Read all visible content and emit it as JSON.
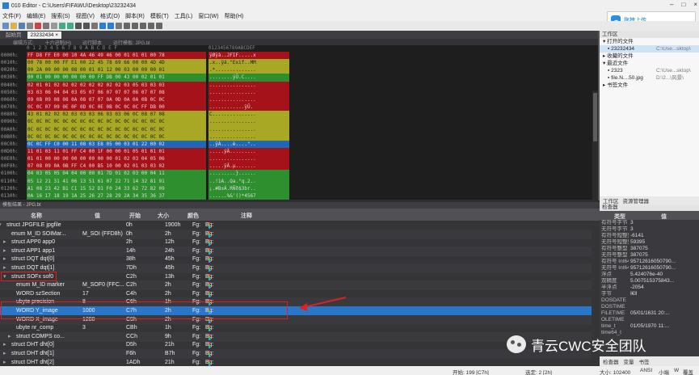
{
  "window": {
    "title": "010 Editor - C:\\Users\\FIFAWU\\Desktop\\23232434",
    "controls": [
      "–",
      "□",
      "×"
    ]
  },
  "menu": [
    "文件(F)",
    "编辑(E)",
    "搜索(S)",
    "视图(V)",
    "格式(O)",
    "脚本(R)",
    "模板(T)",
    "工具(L)",
    "窗口(W)",
    "帮助(H)"
  ],
  "popup": {
    "label": "拖拽上传"
  },
  "tabs": {
    "start": "起始页",
    "file": "23232434 ×"
  },
  "subbar": [
    "编辑方式:",
    "十六进制(H)",
    "运行脚本",
    "运行模板: JPG.bt"
  ],
  "hex": {
    "header_cols": "0  1  2  3  4  5  6  7  8  9  A  B  C  D  E  F",
    "header_ascii": "0123456789ABCDEF",
    "rows": [
      {
        "addr": "0000h:",
        "bytes": "FF D8 FF E0 00 10 4A 46 49 46 00 01 01 01 00 78",
        "ascii": "ÿØÿà..JFIF.....x",
        "color": "red"
      },
      {
        "addr": "0010h:",
        "bytes": "00 78 00 00 FF E1 00 22 45 78 69 66 00 00 4D 4D",
        "ascii": ".x..ÿá.\"Exif..MM",
        "color": "olive"
      },
      {
        "addr": "0020h:",
        "bytes": "00 2A 00 00 00 08 00 01 01 12 00 03 00 00 00 01",
        "ascii": ".*..............",
        "color": "olive"
      },
      {
        "addr": "0030h:",
        "bytes": "00 01 00 00 00 00 00 00 FF DB 00 43 00 02 01 01",
        "ascii": "........ÿÛ.C....",
        "color": "green"
      },
      {
        "addr": "0040h:",
        "bytes": "02 01 01 02 02 02 02 02 02 02 02 03 05 03 03 03",
        "ascii": "................",
        "color": "red"
      },
      {
        "addr": "0050h:",
        "bytes": "03 03 06 04 04 03 05 07 06 07 07 07 06 07 07 08",
        "ascii": "................",
        "color": "red"
      },
      {
        "addr": "0060h:",
        "bytes": "09 0B 09 08 08 0A 08 07 07 0A 0D 0A 0A 0B 0C 0C",
        "ascii": "................",
        "color": "red"
      },
      {
        "addr": "0070h:",
        "bytes": "0C 0C 07 09 0E 0F 0D 0C 0E 0B 0C 0C 0C FF DB 00",
        "ascii": "............ÿÛ.",
        "color": "red"
      },
      {
        "addr": "0080h:",
        "bytes": "43 01 02 02 02 03 03 03 06 03 03 06 0C 08 07 08",
        "ascii": "C...............",
        "color": "olive"
      },
      {
        "addr": "0090h:",
        "bytes": "0C 0C 0C 0C 0C 0C 0C 0C 0C 0C 0C 0C 0C 0C 0C 0C",
        "ascii": "................",
        "color": "olive"
      },
      {
        "addr": "00A0h:",
        "bytes": "0C 0C 0C 0C 0C 0C 0C 0C 0C 0C 0C 0C 0C 0C 0C 0C",
        "ascii": "................",
        "color": "olive"
      },
      {
        "addr": "00B0h:",
        "bytes": "0C 0C 0C 0C 0C 0C 0C 0C 0C 0C 0C 0C 0C 0C 0C 0C",
        "ascii": "................",
        "color": "olive"
      },
      {
        "addr": "00C0h:",
        "bytes": "0C 0C FF C0 00 11 08 03 E8 05 00 03 01 22 00 02",
        "ascii": "..ÿÀ....è....\"..",
        "color": "blue"
      },
      {
        "addr": "00D0h:",
        "bytes": "11 01 03 11 01 FF C4 00 1F 00 00 01 05 01 01 01",
        "ascii": ".....ÿÄ.........",
        "color": "red"
      },
      {
        "addr": "00E0h:",
        "bytes": "01 01 00 00 00 00 00 00 00 00 01 02 03 04 05 06",
        "ascii": "................",
        "color": "red"
      },
      {
        "addr": "00F0h:",
        "bytes": "07 08 09 0A 0B FF C4 00 B5 10 00 02 01 03 03 02",
        "ascii": ".....ÿÄ.µ.......",
        "color": "red"
      },
      {
        "addr": "0100h:",
        "bytes": "04 03 05 05 04 04 00 00 01 7D 01 02 03 00 04 11",
        "ascii": ".........}......",
        "color": "green"
      },
      {
        "addr": "0110h:",
        "bytes": "05 12 21 31 41 06 13 51 61 07 22 71 14 32 81 91",
        "ascii": "..!1A..Qa.\"q.2..",
        "color": "green"
      },
      {
        "addr": "0120h:",
        "bytes": "A1 08 23 42 B1 C1 15 52 D1 F0 24 33 62 72 82 09",
        "ascii": "¡.#B±Á.RÑð$3br..",
        "color": "green"
      },
      {
        "addr": "0130h:",
        "bytes": "0A 16 17 18 19 1A 25 26 27 28 29 2A 34 35 36 37",
        "ascii": "......%&'()*4567",
        "color": "green"
      }
    ]
  },
  "template": {
    "header": "模板结果 - JPG.bt",
    "columns": [
      "名称",
      "值",
      "开始",
      "大小",
      "颜色",
      "注释"
    ],
    "rows": [
      {
        "name": "struct JPGFILE jpgfile",
        "value": "",
        "start": "0h",
        "size": "1900h",
        "fg": "Fg:",
        "bg": "Bg:",
        "indent": 0
      },
      {
        "name": "enum M_ID SOIMar...",
        "value": "M_SOI (FFD8h)",
        "start": "0h",
        "size": "2h",
        "fg": "Fg:",
        "bg": "Bg:",
        "indent": 1
      },
      {
        "name": "struct APP0 app0",
        "value": "",
        "start": "2h",
        "size": "12h",
        "fg": "Fg:",
        "bg": "Bg:",
        "indent": 1
      },
      {
        "name": "struct APP1 app1",
        "value": "",
        "start": "14h",
        "size": "24h",
        "fg": "Fg:",
        "bg": "Bg:",
        "indent": 1
      },
      {
        "name": "struct DQT dqt[0]",
        "value": "",
        "start": "38h",
        "size": "45h",
        "fg": "Fg:",
        "bg": "Bg:",
        "indent": 1
      },
      {
        "name": "struct DQT dqt[1]",
        "value": "",
        "start": "7Dh",
        "size": "45h",
        "fg": "Fg:",
        "bg": "Bg:",
        "indent": 1
      },
      {
        "name": "struct SOFx sof0",
        "value": "",
        "start": "C2h",
        "size": "13h",
        "fg": "Fg:",
        "bg": "Bg:",
        "indent": 1
      },
      {
        "name": "enum M_ID marker",
        "value": "M_SOF0 (FFC...",
        "start": "C2h",
        "size": "2h",
        "fg": "Fg:",
        "bg": "Bg:",
        "indent": 2
      },
      {
        "name": "WORD szSection",
        "value": "17",
        "start": "C4h",
        "size": "2h",
        "fg": "Fg:",
        "bg": "Bg:",
        "indent": 2
      },
      {
        "name": "ubyte precision",
        "value": "8",
        "start": "C6h",
        "size": "1h",
        "fg": "Fg:",
        "bg": "Bg:",
        "indent": 2
      },
      {
        "name": "WORD Y_image",
        "value": "1000",
        "start": "C7h",
        "size": "2h",
        "fg": "Fg:",
        "bg": "Bg:",
        "indent": 2,
        "selected": true
      },
      {
        "name": "WORD X_image",
        "value": "1280",
        "start": "C9h",
        "size": "2h",
        "fg": "Fg:",
        "bg": "Bg:",
        "indent": 2
      },
      {
        "name": "ubyte nr_comp",
        "value": "3",
        "start": "CBh",
        "size": "1h",
        "fg": "Fg:",
        "bg": "Bg:",
        "indent": 2
      },
      {
        "name": "struct COMPS co...",
        "value": "",
        "start": "CCh",
        "size": "9h",
        "fg": "Fg:",
        "bg": "Bg:",
        "indent": 2
      },
      {
        "name": "struct DHT dht[0]",
        "value": "",
        "start": "D5h",
        "size": "21h",
        "fg": "Fg:",
        "bg": "Bg:",
        "indent": 1
      },
      {
        "name": "struct DHT dht[1]",
        "value": "",
        "start": "F6h",
        "size": "B7h",
        "fg": "Fg:",
        "bg": "Bg:",
        "indent": 1
      },
      {
        "name": "struct DHT dht[2]",
        "value": "",
        "start": "1ADh",
        "size": "21h",
        "fg": "Fg:",
        "bg": "Bg:",
        "indent": 1
      }
    ]
  },
  "workspace": {
    "header": "工作区",
    "open_label": "打开的文件",
    "open_file": "23232434",
    "open_path": "C:\\Use...sktop\\",
    "fav_label": "收藏的文件",
    "recent_label": "最近文件",
    "recent": [
      {
        "name": "2323",
        "path": "C:\\Use...sktop\\"
      },
      {
        "name": "file.N....50.jpg",
        "path": "D:\\2...\\风景\\"
      }
    ],
    "bookmarks_label": "书签文件",
    "tabs": [
      "工作区",
      "资源管理器"
    ]
  },
  "inspector": {
    "header": "检查器",
    "columns": [
      "类型",
      "值"
    ],
    "rows": [
      {
        "t": "有符号字节",
        "v": "3"
      },
      {
        "t": "无符号字节",
        "v": "3"
      },
      {
        "t": "有符号短整型",
        "v": "-6141"
      },
      {
        "t": "无符号短整型",
        "v": "59395"
      },
      {
        "t": "有符号整型",
        "v": "387075"
      },
      {
        "t": "无符号整型",
        "v": "387075"
      },
      {
        "t": "有符号 Int64",
        "v": "95712616050790..."
      },
      {
        "t": "无符号 Int64",
        "v": "95712616050790..."
      },
      {
        "t": "浮点",
        "v": "5.424076e-40"
      },
      {
        "t": "双精度",
        "v": "5.007515375843..."
      },
      {
        "t": "半浮点",
        "v": "-2054"
      },
      {
        "t": "字节",
        "v": "Ì€ll"
      },
      {
        "t": "DOSDATE",
        "v": ""
      },
      {
        "t": "DOSTIME",
        "v": ""
      },
      {
        "t": "FILETIME",
        "v": "05/01/1631 20:..."
      },
      {
        "t": "OLETIME",
        "v": ""
      },
      {
        "t": "time_t",
        "v": "01/05/1970 11:..."
      },
      {
        "t": "time64_t",
        "v": ""
      }
    ],
    "tabs": [
      "检查器",
      "变量",
      "书签"
    ]
  },
  "status": {
    "start": "开始: 199 [C7h]",
    "selected": "选定: 2 [2h]",
    "size": "大小: 102400",
    "encoding": "ANSI",
    "endian": "小端",
    "mode": "W",
    "overwrite": "覆盖"
  },
  "watermark": {
    "text": "青云CWC安全团队"
  },
  "colors": {
    "red": "#a6121a",
    "olive": "#a8a825",
    "green": "#2e8f2e",
    "blue": "#1f68b8",
    "selected": "#2a76c9",
    "annotation": "#e02020"
  }
}
